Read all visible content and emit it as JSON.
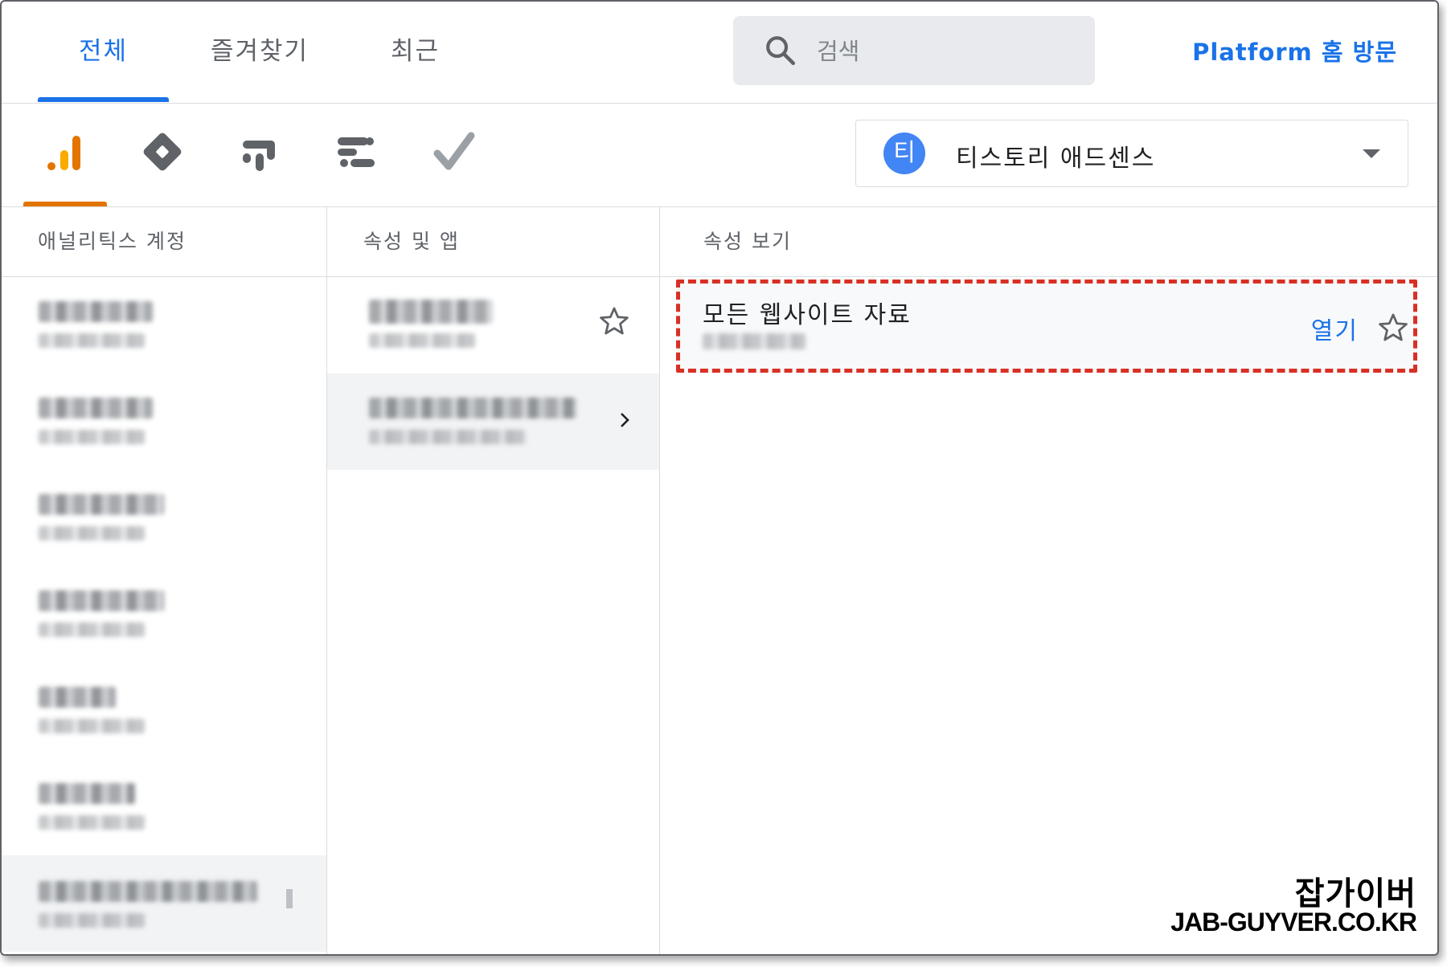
{
  "tabs": [
    {
      "label": "전체",
      "active": true
    },
    {
      "label": "즐겨찾기",
      "active": false
    },
    {
      "label": "최근",
      "active": false
    }
  ],
  "search": {
    "placeholder": "검색",
    "icon": "search-icon"
  },
  "platform_link": "Platform 홈 방문",
  "products": [
    {
      "name": "analytics-icon",
      "active": true
    },
    {
      "name": "tag-manager-icon",
      "active": false
    },
    {
      "name": "optimize-icon",
      "active": false
    },
    {
      "name": "data-studio-icon",
      "active": false
    },
    {
      "name": "surveys-icon",
      "active": false
    }
  ],
  "account_selector": {
    "avatar_letter": "티",
    "name": "티스토리 애드센스",
    "avatar_color": "#4285f4"
  },
  "columns": {
    "accounts": {
      "header": "애널리틱스 계정"
    },
    "properties": {
      "header": "속성 및 앱"
    },
    "views": {
      "header": "속성 보기"
    }
  },
  "views": [
    {
      "title": "모든 웹사이트 자료",
      "open_label": "열기"
    }
  ],
  "colors": {
    "accent": "#1a73e8",
    "analytics_orange": "#e37400",
    "highlight_border": "#d93025"
  },
  "watermark": {
    "korean": "잡가이버",
    "domain": "JAB-GUYVER.CO.KR"
  }
}
